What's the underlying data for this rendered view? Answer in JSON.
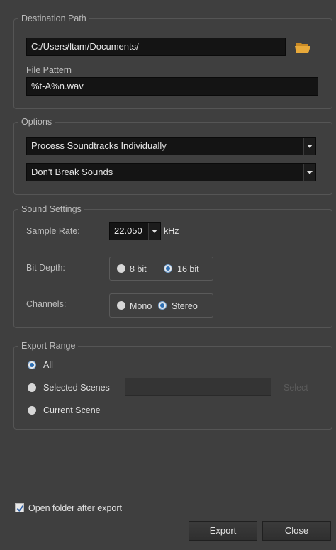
{
  "destination": {
    "title": "Destination Path",
    "path_value": "C:/Users/ltam/Documents/",
    "file_pattern_label": "File Pattern",
    "file_pattern_value": "%t-A%n.wav",
    "browse_icon": "folder-icon"
  },
  "options": {
    "title": "Options",
    "soundtracks_selected": "Process Soundtracks Individually",
    "break_selected": "Don't Break Sounds"
  },
  "sound_settings": {
    "title": "Sound Settings",
    "sample_rate_label": "Sample Rate:",
    "sample_rate_value": "22.050",
    "sample_rate_unit": "kHz",
    "bit_depth_label": "Bit Depth:",
    "bit_depth_options": [
      "8 bit",
      "16 bit"
    ],
    "bit_depth_selected": "16 bit",
    "channels_label": "Channels:",
    "channels_options": [
      "Mono",
      "Stereo"
    ],
    "channels_selected": "Stereo"
  },
  "export_range": {
    "title": "Export Range",
    "all_label": "All",
    "selected_scenes_label": "Selected Scenes",
    "selected_scenes_value": "",
    "select_button": "Select",
    "current_scene_label": "Current Scene",
    "selected": "All"
  },
  "footer": {
    "open_folder_label": "Open folder after export",
    "open_folder_checked": true,
    "export_button": "Export",
    "close_button": "Close"
  },
  "colors": {
    "background": "#3f3f3f",
    "field": "#141414",
    "radio_accent": "#2d6fb4",
    "folder_icon": "#e8a93a"
  }
}
